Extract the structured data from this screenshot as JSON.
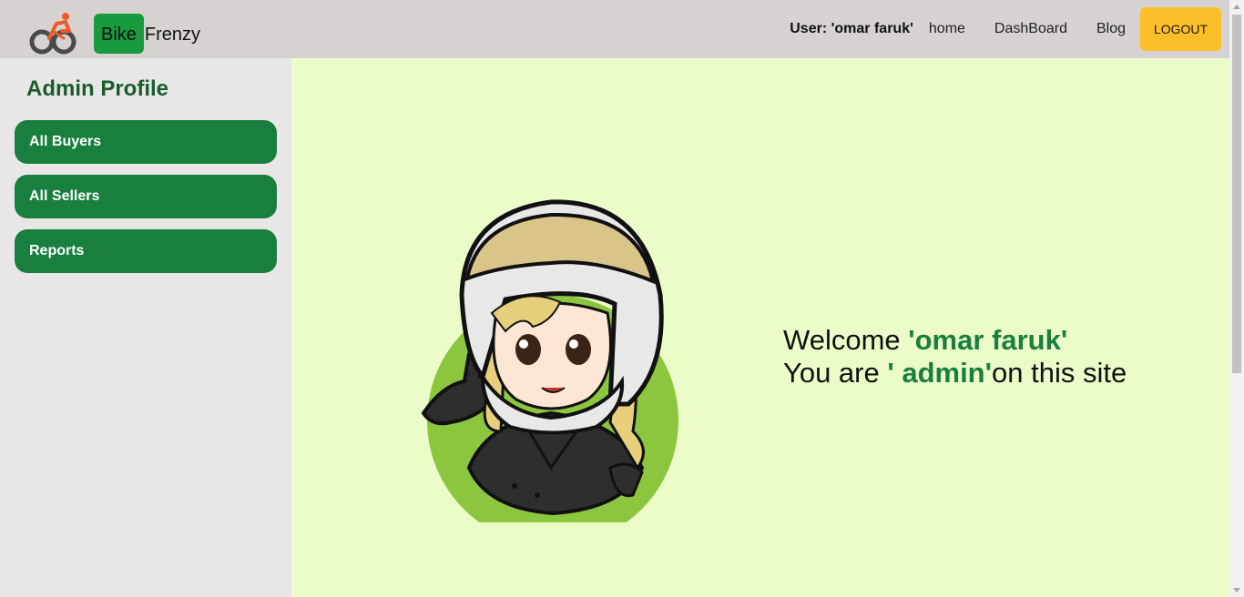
{
  "header": {
    "brand_part1": "Bike",
    "brand_part2": "Frenzy",
    "user_text": "User: 'omar faruk'",
    "nav": [
      "home",
      "DashBoard",
      "Blog"
    ],
    "logout_label": "LOGOUT"
  },
  "sidebar": {
    "title": "Admin Profile",
    "items": [
      {
        "label": "All Buyers"
      },
      {
        "label": "All Sellers"
      },
      {
        "label": "Reports"
      }
    ]
  },
  "main": {
    "welcome_prefix": "Welcome ",
    "user_name": "'omar faruk'",
    "role_prefix": "You are ",
    "role": "' admin'",
    "role_suffix": "on this site",
    "avatar_icon": "rider-avatar-icon"
  },
  "colors": {
    "primary_green": "#187f3f",
    "logout_yellow": "#fcbf2a",
    "main_bg": "#ecfcc8",
    "sidebar_bg": "#e8e6e7",
    "header_bg": "#d6d2d1"
  }
}
